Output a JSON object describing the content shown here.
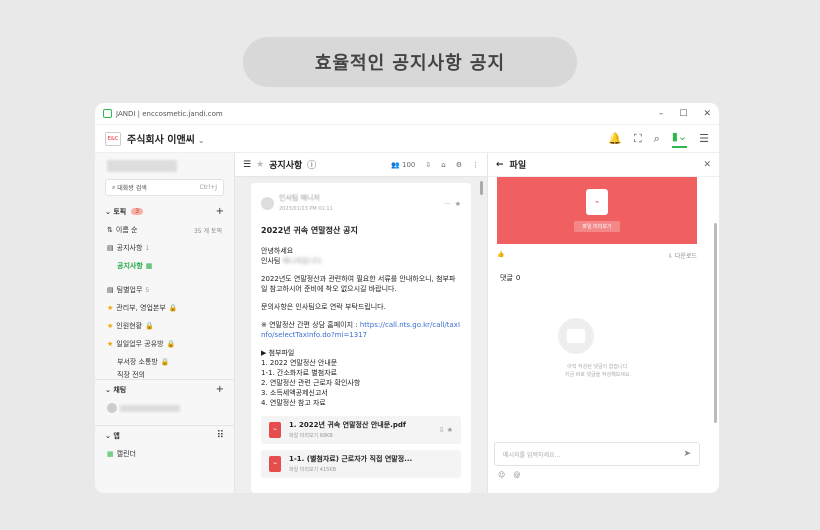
{
  "banner": {
    "text": "효율적인 공지사항 공지"
  },
  "titlebar": {
    "text": "JANDI | enccosmetic.jandi.com"
  },
  "workspace": {
    "name": "주식회사 이앤씨",
    "caret": "⌄"
  },
  "left": {
    "search_label": "대화방 검색",
    "search_shortcut": "Ctrl+J",
    "topics_label": "토픽",
    "topics_badge": "3",
    "sort_label": "이름 순",
    "sort_count": "35 개 토픽",
    "folder1": "공지사항",
    "folder1_count": "1",
    "active_item": "공지사항",
    "folder2": "팀별업무",
    "folder2_count": "5",
    "items": [
      "관리부, 영업본부",
      "인원현황",
      "일일업무 공유방",
      "부서장 소통방",
      "직장 전의"
    ],
    "chat_label": "채팅",
    "apps_label": "앱",
    "calendar": "캘린더"
  },
  "mid": {
    "title": "공지사항",
    "member_count": "100",
    "post_title": "2022년 귀속 연말정산 공지",
    "author_date": "2023/01/13 PM 01:11",
    "p1": "안녕하세요",
    "p1b": "인사팀",
    "p2": "2022년도 연말정산과 관련하여 필요한 서류를 안내하오니, 첨부파일 참고하시어 준비에 착오 없으시길 바랍니다.",
    "p3": "문의사항은 인사팀으로 연락 부탁드립니다.",
    "link_label": "※ 연말정산 간편 상담 홈페이지 :",
    "link_url": "https://call.nts.go.kr/call/taxInfo/selectTaxInfo.do?mi=1317",
    "attach_head": "▶ 첨부파일",
    "attach_list": [
      "1. 2022 연말정산 안내문",
      "1-1. 간소화자료 별첨자료",
      "2. 연말정산 관련 근로자 확인사항",
      "3. 소득세액공제신고서",
      "4. 연말정산 참고 자료"
    ],
    "file1_name": "1. 2022년 귀속 연말정산 안내문.pdf",
    "file1_meta": "파일 미리보기 68KB",
    "file2_name": "1-1. (별첨자료) 근로자가 직접 연말정...",
    "file2_meta": "파일 미리보기 415KB"
  },
  "right": {
    "title": "파일",
    "preview_button": "파일 미리보기",
    "download": "다운로드",
    "comments_label": "댓글",
    "comments_count": "0",
    "empty_line1": "아직 작성된 댓글이 없습니다.",
    "empty_line2": "지금 바로 댓글을 작성해보세요.",
    "input_placeholder": "메시지를 입력하세요..."
  }
}
